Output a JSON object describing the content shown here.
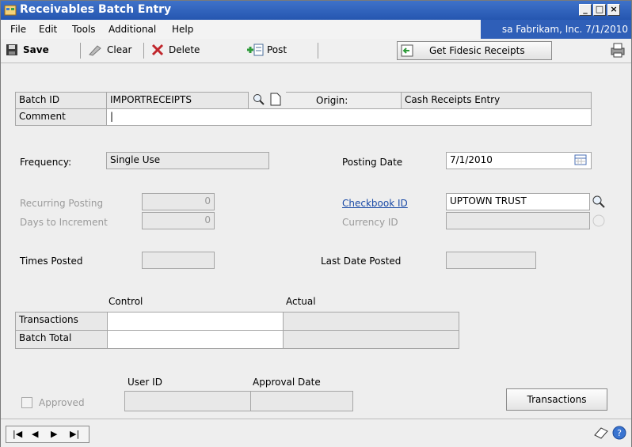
{
  "window": {
    "title": "Receivables Batch Entry"
  },
  "menu": {
    "file": "File",
    "edit": "Edit",
    "tools": "Tools",
    "additional": "Additional",
    "help": "Help",
    "company_info": "sa  Fabrikam, Inc.  7/1/2010"
  },
  "toolbar": {
    "save": "Save",
    "clear": "Clear",
    "delete": "Delete",
    "post": "Post",
    "get_fidesic": "Get Fidesic Receipts"
  },
  "form": {
    "batch_id_label": "Batch ID",
    "batch_id_value": "IMPORTRECEIPTS",
    "origin_label": "Origin:",
    "origin_value": "Cash Receipts Entry",
    "comment_label": "Comment",
    "comment_value": "|",
    "frequency_label": "Frequency:",
    "frequency_value": "Single Use",
    "posting_date_label": "Posting Date",
    "posting_date_value": "7/1/2010",
    "recurring_posting_label": "Recurring Posting",
    "recurring_posting_value": "0",
    "days_to_increment_label": "Days to Increment",
    "days_to_increment_value": "0",
    "checkbook_id_label": "Checkbook ID",
    "checkbook_id_value": "UPTOWN TRUST",
    "currency_id_label": "Currency ID",
    "times_posted_label": "Times Posted",
    "last_date_posted_label": "Last Date Posted",
    "control_header": "Control",
    "actual_header": "Actual",
    "transactions_label": "Transactions",
    "batch_total_label": "Batch Total",
    "user_id_header": "User ID",
    "approval_date_header": "Approval Date",
    "approved_label": "Approved",
    "transactions_button": "Transactions"
  },
  "icons": [
    "window-icon",
    "save-icon",
    "clear-icon",
    "delete-icon",
    "post-icon",
    "fidesic-icon",
    "print-icon",
    "lookup-icon",
    "new-note-icon",
    "calendar-icon",
    "note-icon",
    "help-icon"
  ],
  "colors": {
    "titlebar": "#2556b0",
    "company_bg": "#2f5fb8",
    "link": "#1a4aa6"
  }
}
